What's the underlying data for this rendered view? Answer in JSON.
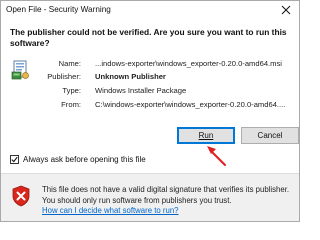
{
  "window": {
    "title": "Open File - Security Warning"
  },
  "warning": {
    "headline": "The publisher could not be verified.  Are you sure you want to run this software?"
  },
  "details": {
    "name_label": "Name:",
    "name_value": "...indows-exporter\\windows_exporter-0.20.0-amd64.msi",
    "publisher_label": "Publisher:",
    "publisher_value": "Unknown Publisher",
    "type_label": "Type:",
    "type_value": "Windows Installer Package",
    "from_label": "From:",
    "from_value": "C:\\windows-exporter\\windows_exporter-0.20.0-amd64...."
  },
  "buttons": {
    "run_label": "Run",
    "cancel_label": "Cancel"
  },
  "option": {
    "always_ask_label": "Always ask before opening this file",
    "always_ask_checked": true
  },
  "footer": {
    "message": "This file does not have a valid digital signature that verifies its publisher.  You should only run software from publishers you trust.",
    "link_text": "How can I decide what software to run?"
  },
  "colors": {
    "accent": "#0078d7",
    "link": "#0066cc",
    "arrow": "#e02020",
    "shield": "#d9261c"
  },
  "icons": {
    "close": "close-icon",
    "package": "installer-package-icon",
    "annotation": "red-arrow-icon",
    "security": "security-shield-icon"
  }
}
